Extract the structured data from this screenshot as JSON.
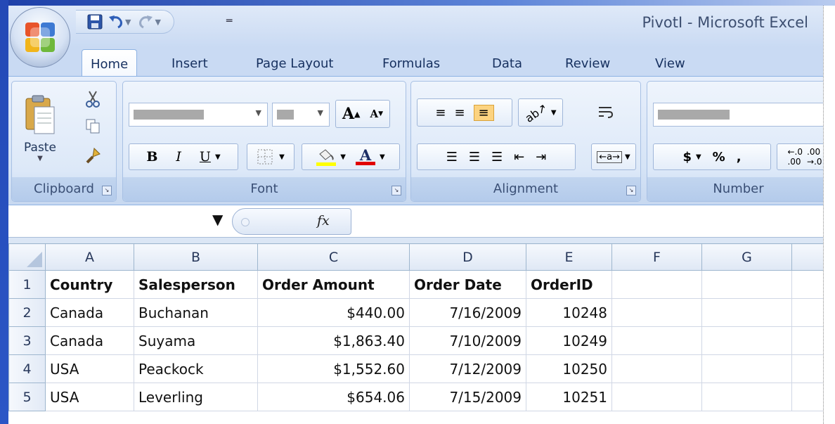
{
  "window": {
    "title": "PivotI - Microsoft Excel",
    "accent": "#c9daf3"
  },
  "quick_access": {
    "icons": [
      "save-icon",
      "undo-icon",
      "redo-icon",
      "customize-icon"
    ]
  },
  "ribbon_tabs": [
    {
      "label": "Home",
      "active": true
    },
    {
      "label": "Insert"
    },
    {
      "label": "Page Layout"
    },
    {
      "label": "Formulas"
    },
    {
      "label": "Data"
    },
    {
      "label": "Review"
    },
    {
      "label": "View"
    }
  ],
  "ribbon": {
    "clipboard": {
      "label": "Clipboard",
      "paste_label": "Paste"
    },
    "font": {
      "label": "Font",
      "bold": "B",
      "italic": "I",
      "underline": "U",
      "font_color_glyph": "A",
      "grow_glyph": "A",
      "shrink_glyph": "A"
    },
    "alignment": {
      "label": "Alignment"
    },
    "number": {
      "label": "Number",
      "currency": "$",
      "percent": "%",
      "comma": ","
    }
  },
  "formula_bar": {
    "fx_label": "fx",
    "value": ""
  },
  "sheet": {
    "columns": [
      "A",
      "B",
      "C",
      "D",
      "E",
      "F",
      "G",
      ""
    ],
    "rows": [
      {
        "n": "1",
        "cells": [
          "Country",
          "Salesperson",
          "Order Amount",
          "Order Date",
          "OrderID",
          "",
          "",
          ""
        ]
      },
      {
        "n": "2",
        "cells": [
          "Canada",
          "Buchanan",
          "$440.00",
          "7/16/2009",
          "10248",
          "",
          "",
          ""
        ]
      },
      {
        "n": "3",
        "cells": [
          "Canada",
          "Suyama",
          "$1,863.40",
          "7/10/2009",
          "10249",
          "",
          "",
          ""
        ]
      },
      {
        "n": "4",
        "cells": [
          "USA",
          "Peackock",
          "$1,552.60",
          "7/12/2009",
          "10250",
          "",
          "",
          ""
        ]
      },
      {
        "n": "5",
        "cells": [
          "USA",
          "Leverling",
          "$654.06",
          "7/15/2009",
          "10251",
          "",
          "",
          ""
        ]
      }
    ]
  }
}
